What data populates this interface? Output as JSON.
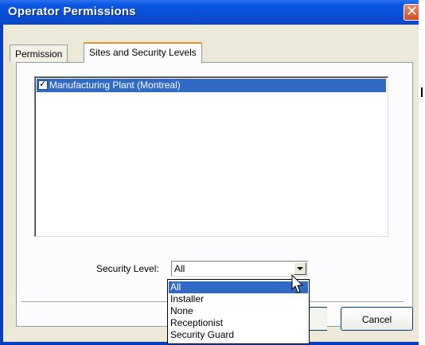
{
  "window": {
    "title": "Operator Permissions"
  },
  "tabs": [
    {
      "label": "Permission",
      "active": false
    },
    {
      "label": "Sites and Security Levels",
      "active": true
    }
  ],
  "sites": {
    "items": [
      {
        "label": "Manufacturing Plant (Montreal)",
        "checked": true,
        "selected": true
      }
    ]
  },
  "security_level": {
    "label": "Security Level:",
    "value": "All",
    "options": [
      "All",
      "Installer",
      "None",
      "Receptionist",
      "Security Guard"
    ],
    "highlighted": "All"
  },
  "buttons": {
    "cancel": "Cancel"
  },
  "icons": {
    "close": "close-icon",
    "check": "check-icon",
    "dropdown_arrow": "chevron-down-icon",
    "cursor": "mouse-pointer-icon"
  },
  "colors": {
    "titlebar": "#0a4fd8",
    "selection": "#316ac5",
    "dialog_bg": "#ece9d8",
    "close_button": "#d24a22",
    "active_tab_accent": "#e69528"
  }
}
